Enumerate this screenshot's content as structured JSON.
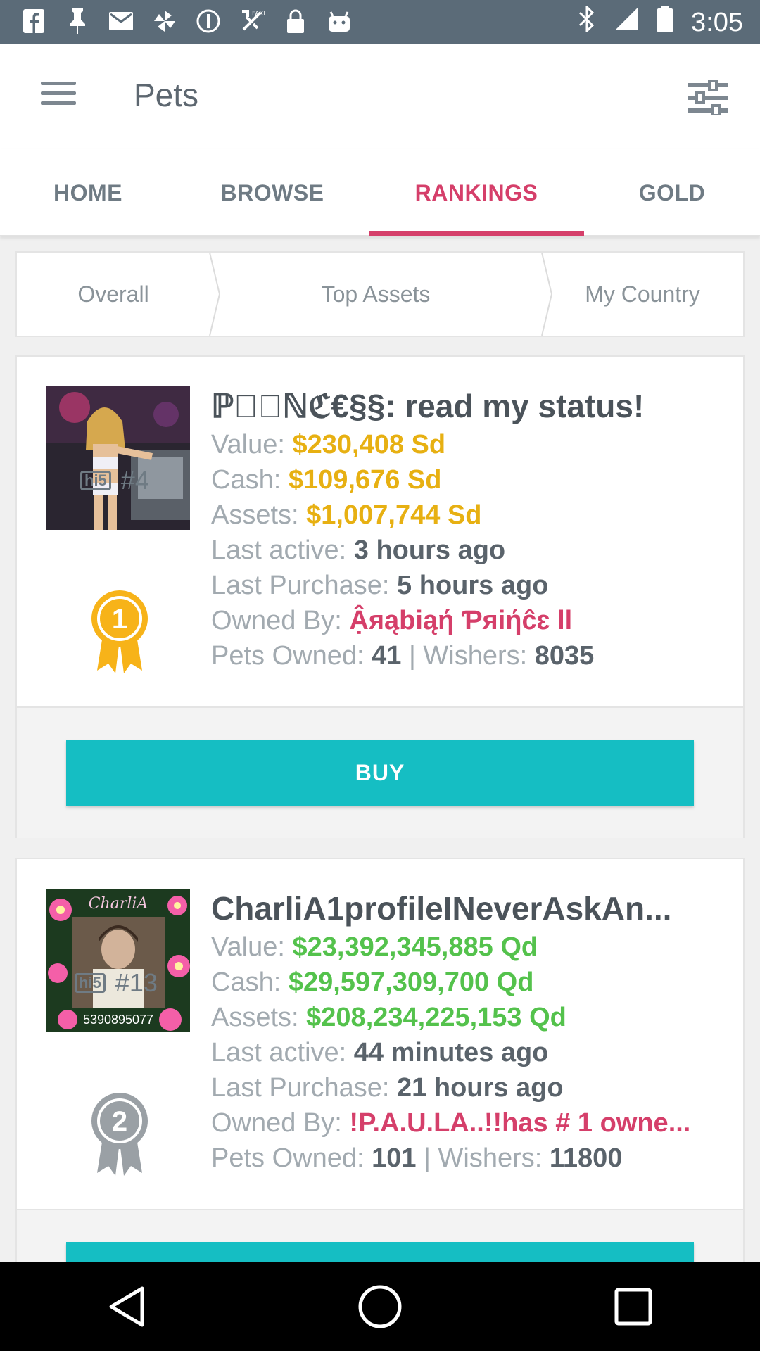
{
  "status_bar": {
    "time": "3:05",
    "icons": [
      "facebook-icon",
      "pin-icon",
      "mail-icon",
      "pinwheel-icon",
      "do-not-disturb-icon",
      "fake-gps-icon",
      "lock-icon",
      "android-icon",
      "bluetooth-icon",
      "signal-icon",
      "battery-icon"
    ]
  },
  "toolbar": {
    "title": "Pets",
    "menu_icon": "menu-icon",
    "filter_icon": "filter-sliders-icon"
  },
  "tabs": [
    {
      "label": "HOME",
      "active": false
    },
    {
      "label": "BROWSE",
      "active": false
    },
    {
      "label": "RANKINGS",
      "active": true
    },
    {
      "label": "GOLD",
      "active": false
    }
  ],
  "segments": [
    {
      "label": "Overall"
    },
    {
      "label": "Top Assets"
    },
    {
      "label": "My Country"
    }
  ],
  "labels": {
    "value": "Value: ",
    "cash": "Cash: ",
    "assets": "Assets: ",
    "last_active": "Last active: ",
    "last_purchase": "Last Purchase: ",
    "owned_by": "Owned By: ",
    "pets_owned": "Pets Owned: ",
    "wishers": " | Wishers: ",
    "buy": "BUY"
  },
  "cards": [
    {
      "name": "ℙℜ⃞ℕℭ€§§: read my status!",
      "value": "$230,408 Sd",
      "cash": "$109,676 Sd",
      "assets": "$1,007,744 Sd",
      "last_active": "3 hours ago",
      "last_purchase": "5 hours ago",
      "owned_by": "Ậяąbiąή Ƥяiήĉɛ ll",
      "pets_owned": "41",
      "wishers": "8035",
      "rank_badge": "hi5",
      "rank": "#4",
      "medal": "1",
      "medal_color": "#f7b319",
      "value_color": "#e7b012"
    },
    {
      "name": "CharliA1profileINeverAskAn...",
      "value": "$23,392,345,885 Qd",
      "cash": "$29,597,309,700 Qd",
      "assets": "$208,234,225,153 Qd",
      "last_active": "44 minutes ago",
      "last_purchase": "21 hours ago",
      "owned_by": "!P.A.U.LA..!!has # 1 owne...",
      "pets_owned": "101",
      "wishers": "11800",
      "rank_badge": "hi5",
      "rank": "#13",
      "medal": "2",
      "medal_color": "#9aa0a5",
      "value_color": "#54c24c",
      "image_text": "CharliA",
      "image_number": "5390895077"
    }
  ],
  "colors": {
    "accent": "#d53f6a",
    "buy": "#15bec3",
    "status_bar": "#5b6b78"
  },
  "nav": [
    "back-icon",
    "home-icon",
    "recents-icon"
  ]
}
